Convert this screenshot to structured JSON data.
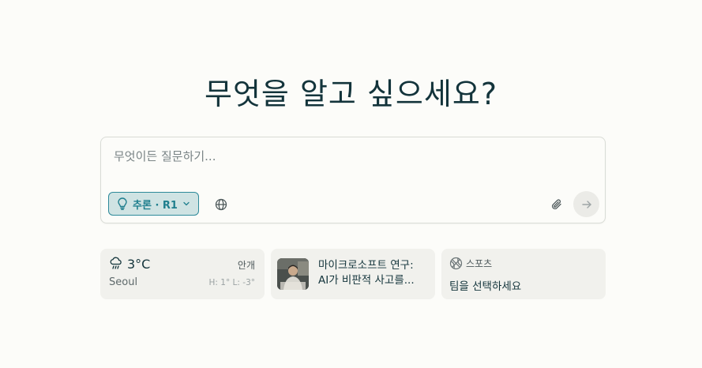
{
  "heading": "무엇을 알고 싶으세요?",
  "search": {
    "placeholder": "무엇이든 질문하기...",
    "mode_label": "추론 · R1",
    "icons": {
      "mode": "lightbulb-icon",
      "mode_chevron": "chevron-down-icon",
      "source": "globe-icon",
      "attach": "paperclip-icon",
      "submit": "arrow-right-icon"
    }
  },
  "widgets": {
    "weather": {
      "icon": "cloud-rain-icon",
      "temperature": "3°C",
      "condition": "안개",
      "city": "Seoul",
      "high_low": "H: 1° L: -3°"
    },
    "news": {
      "line1": "마이크로소프트 연구:",
      "line2": "AI가 비판적 사고를..."
    },
    "sports": {
      "icon": "basketball-icon",
      "label": "스포츠",
      "prompt": "팀을 선택하세요"
    }
  },
  "colors": {
    "background": "#fcfcf9",
    "accent": "#1f7f8e",
    "accent_bg": "#cfe3e3",
    "card_bg": "#f1f1ed",
    "text": "#13343b"
  }
}
